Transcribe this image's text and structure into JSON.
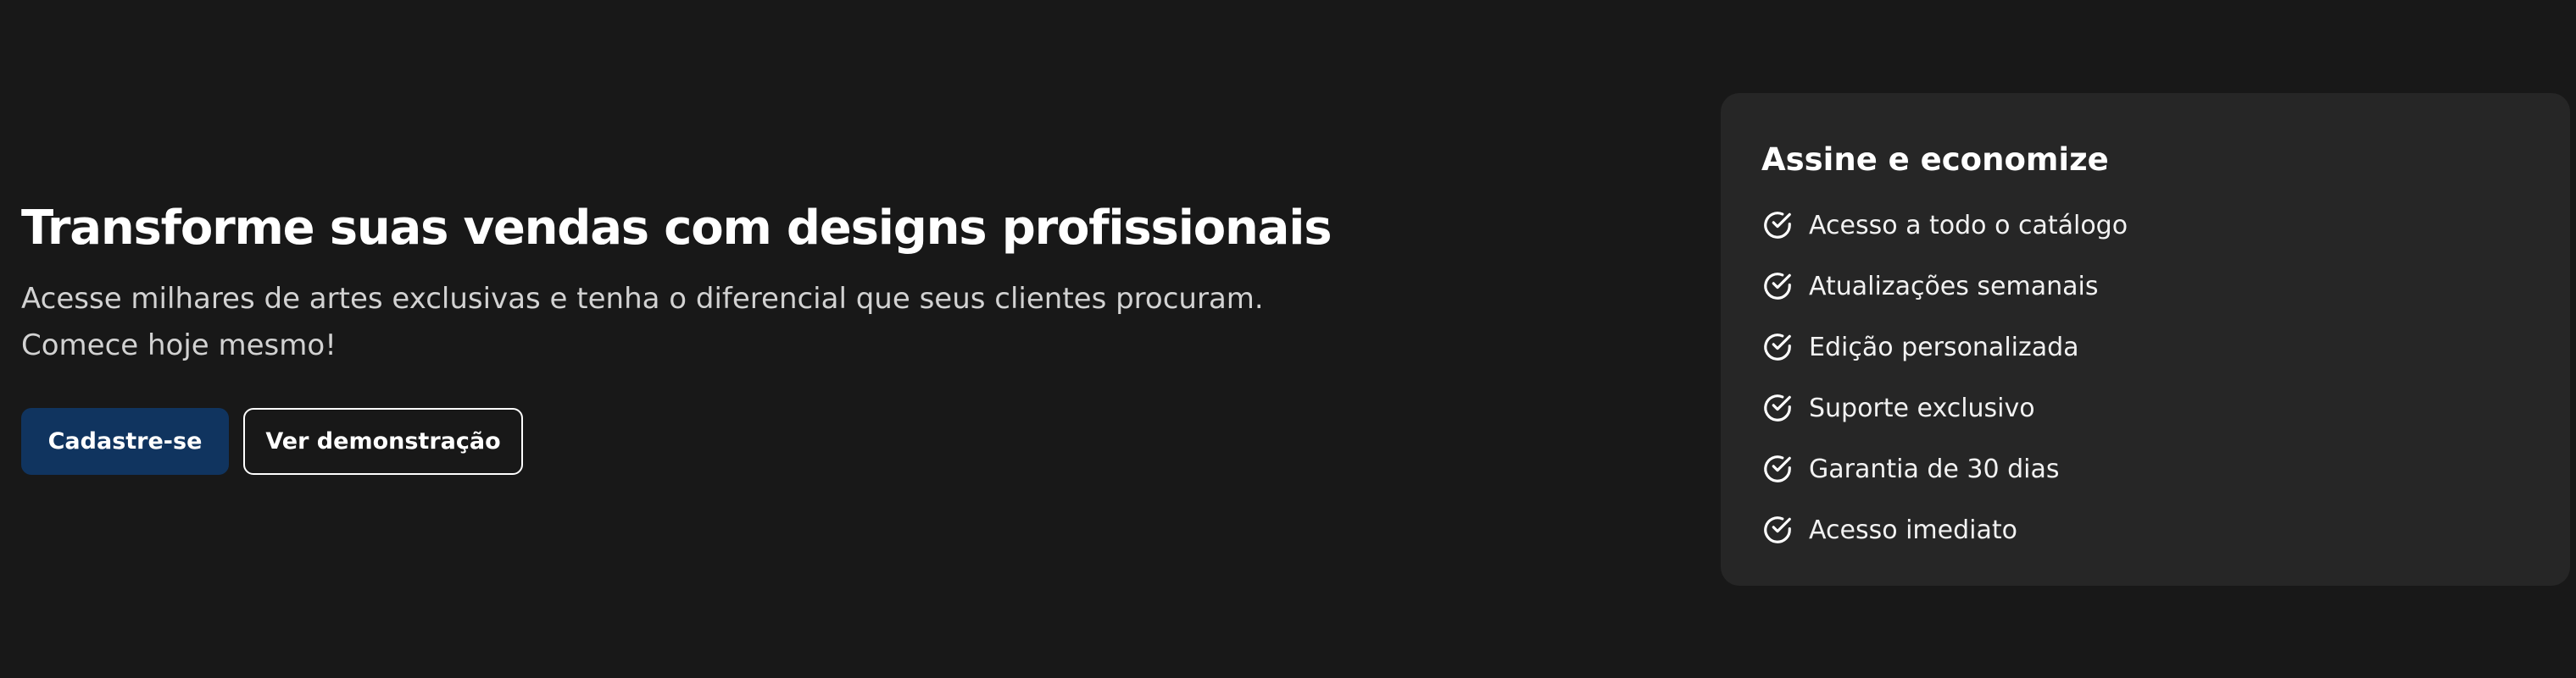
{
  "hero": {
    "title": "Transforme suas vendas com designs profissionais",
    "subtitle": "Acesse milhares de artes exclusivas e tenha o diferencial que seus clientes procuram. Comece hoje mesmo!",
    "primary_button": "Cadastre-se",
    "secondary_button": "Ver demonstração"
  },
  "card": {
    "title": "Assine e economize",
    "benefits": [
      {
        "label": "Acesso a todo o catálogo",
        "icon": "check-circle-icon"
      },
      {
        "label": "Atualizações semanais",
        "icon": "check-circle-icon"
      },
      {
        "label": "Edição personalizada",
        "icon": "check-circle-icon"
      },
      {
        "label": "Suporte exclusivo",
        "icon": "check-circle-icon"
      },
      {
        "label": "Garantia de 30 dias",
        "icon": "check-circle-icon"
      },
      {
        "label": "Acesso imediato",
        "icon": "check-circle-icon"
      }
    ]
  },
  "colors": {
    "background": "#181818",
    "card_background": "#262626",
    "primary_button": "#10345f",
    "text": "#ffffff",
    "muted_text": "#d2d2d2"
  }
}
